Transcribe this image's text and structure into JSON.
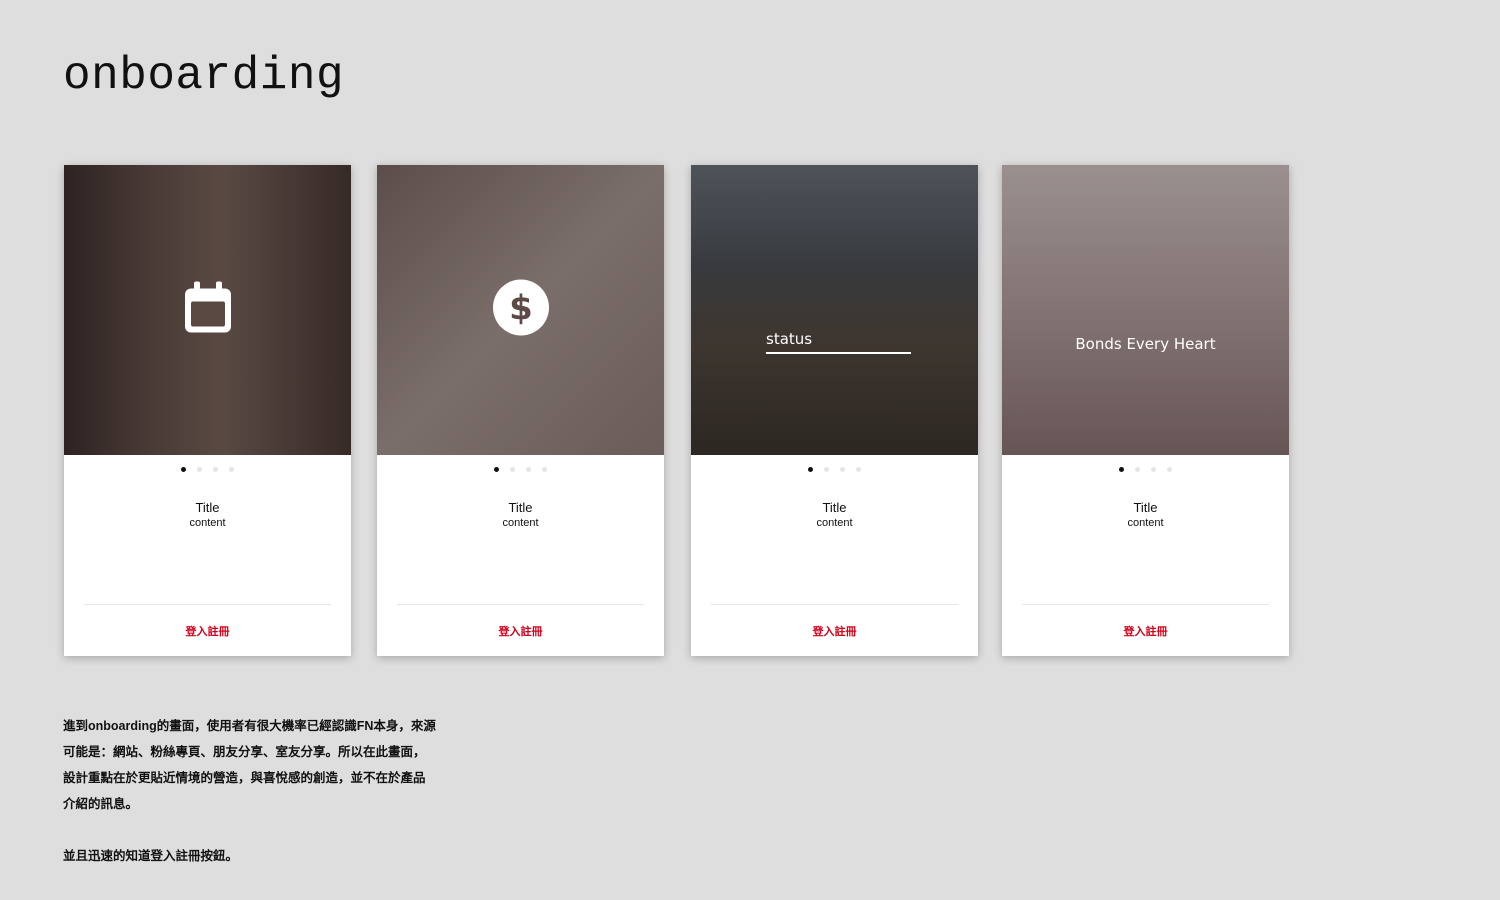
{
  "page": {
    "title": "onboarding"
  },
  "cards": [
    {
      "hero_icon": "calendar-icon",
      "title": "Title",
      "content": "content",
      "login": "登入註冊"
    },
    {
      "hero_icon": "dollar-icon",
      "title": "Title",
      "content": "content",
      "login": "登入註冊"
    },
    {
      "hero_text": "status",
      "title": "Title",
      "content": "content",
      "login": "登入註冊"
    },
    {
      "hero_text": "Bonds Every Heart",
      "title": "Title",
      "content": "content",
      "login": "登入註冊"
    }
  ],
  "pagination": {
    "total": 4,
    "active": 1
  },
  "description": {
    "lines": [
      "進到onboarding的畫面，使用者有很大機率已經認識FN本身，來源",
      "可能是：網站、粉絲專頁、朋友分享、室友分享。所以在此畫面，",
      "設計重點在於更貼近情境的營造，與喜悅感的創造，並不在於產品",
      "介紹的訊息。"
    ],
    "note": "並且迅速的知道登入註冊按鈕。"
  }
}
